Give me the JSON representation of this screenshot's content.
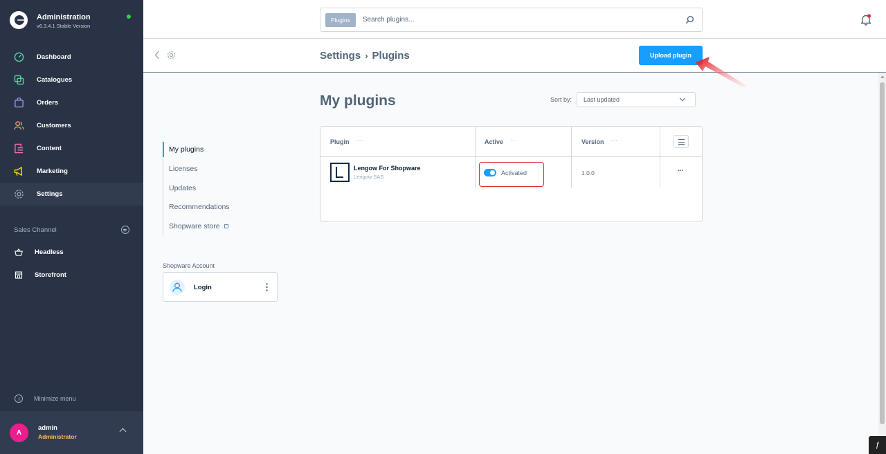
{
  "brand": {
    "title": "Administration",
    "version": "v6.3.4.1 Stable Version"
  },
  "nav": {
    "items": [
      {
        "label": "Dashboard",
        "icon": "dashboard-gauge-icon",
        "color": "#57d9a3"
      },
      {
        "label": "Catalogues",
        "icon": "catalogues-icon",
        "color": "#57d9a3"
      },
      {
        "label": "Orders",
        "icon": "orders-bag-icon",
        "color": "#a092f0"
      },
      {
        "label": "Customers",
        "icon": "customers-icon",
        "color": "#f88962"
      },
      {
        "label": "Content",
        "icon": "content-icon",
        "color": "#ff68b4"
      },
      {
        "label": "Marketing",
        "icon": "marketing-megaphone-icon",
        "color": "#ffd700"
      },
      {
        "label": "Settings",
        "icon": "settings-gear-icon",
        "color": "#9aa8b5"
      }
    ]
  },
  "sales_channel": {
    "header": "Sales Channel",
    "items": [
      {
        "label": "Headless"
      },
      {
        "label": "Storefront"
      }
    ]
  },
  "minimize_label": "Minimize menu",
  "user": {
    "initial": "A",
    "name": "admin",
    "role": "Administrator"
  },
  "search": {
    "badge": "Plugins",
    "placeholder": "Search plugins..."
  },
  "breadcrumb": {
    "part1": "Settings",
    "separator": "›",
    "part2": "Plugins"
  },
  "upload_button": "Upload plugin",
  "side_menu": {
    "items": [
      "My plugins",
      "Licenses",
      "Updates",
      "Recommendations",
      "Shopware store"
    ]
  },
  "account": {
    "label": "Shopware Account",
    "login": "Login"
  },
  "main": {
    "title": "My plugins",
    "sort_label": "Sort by:",
    "sort_value": "Last updated"
  },
  "grid": {
    "columns": [
      "Plugin",
      "Active",
      "Version"
    ],
    "column_dots": "···",
    "rows": [
      {
        "name": "Lengow For Shopware",
        "vendor": "Lengow SAS",
        "active_label": "Activated",
        "active": true,
        "version": "1.0.0",
        "action": "···"
      }
    ]
  },
  "colors": {
    "accent": "#189eff",
    "sidebar": "#2a3345",
    "highlight": "#e02b35"
  }
}
